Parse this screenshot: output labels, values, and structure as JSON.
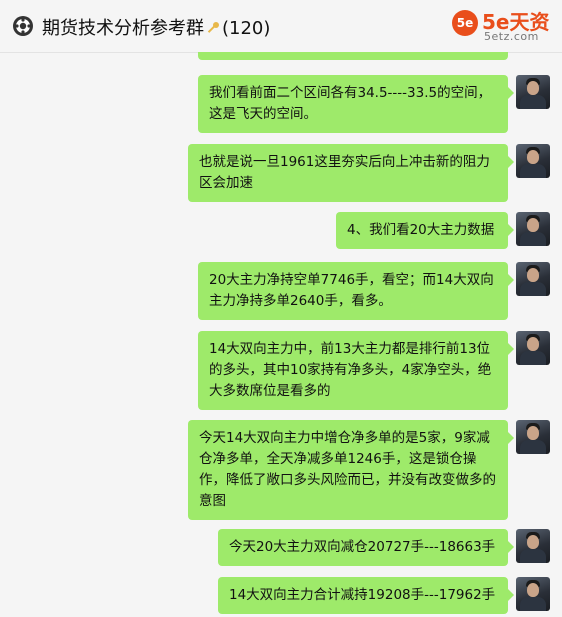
{
  "header": {
    "title": "期货技术分析参考群",
    "member_count": "(120)",
    "title_icon": "key-icon",
    "group_icon": "gear-group-icon"
  },
  "watermark": {
    "badge": "5e",
    "brand": "5e天资",
    "domain": "5etz.com"
  },
  "colors": {
    "bubble": "#9eea6a",
    "background": "#f5f5f5",
    "brand": "#e94e1b"
  },
  "messages": [
    {
      "text": "我们看前面二个区间各有34.5----33.5的空间，这是飞天的空间。"
    },
    {
      "text": "也就是说一旦1961这里夯实后向上冲击新的阻力区会加速"
    },
    {
      "text": "4、我们看20大主力数据"
    },
    {
      "text": "20大主力净持空单7746手，看空；而14大双向主力净持多单2640手，看多。"
    },
    {
      "text": "14大双向主力中，前13大主力都是排行前13位的多头，其中10家持有净多头，4家净空头，绝大多数席位是看多的"
    },
    {
      "text": "今天14大双向主力中增仓净多单的是5家，9家减仓净多单，全天净减多单1246手，这是锁仓操作，降低了敞口多头风险而已，并没有改变做多的意图"
    },
    {
      "text": "今天20大主力双向减仓20727手---18663手"
    },
    {
      "text": "14大双向主力合计减持19208手---17962手"
    }
  ]
}
